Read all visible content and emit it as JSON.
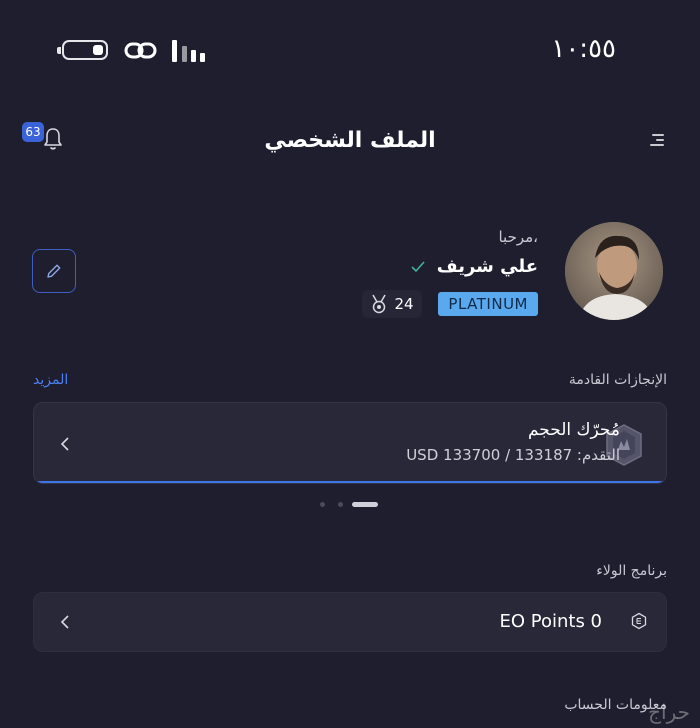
{
  "status_bar": {
    "time": "١٠:٥٥"
  },
  "header": {
    "title": "الملف الشخصي",
    "notification_count": "63"
  },
  "profile": {
    "greeting": "مرحبا،",
    "name": "علي شريف",
    "tier": "PLATINUM",
    "medal_count": "24"
  },
  "achievements": {
    "section_title": "الإنجازات القادمة",
    "more_label": "المزيد",
    "card": {
      "name": "مُحرّك الحجم",
      "progress_text": "التقدم: 133187 / 133700 USD",
      "progress_fraction": 0.996
    },
    "pager": {
      "count": 3,
      "active_index": 0
    }
  },
  "loyalty": {
    "section_title": "برنامج الولاء",
    "points_text": "EO Points 0"
  },
  "account": {
    "section_title": "معلومات الحساب"
  },
  "watermark": "حراج",
  "colors": {
    "background": "#1e1e2e",
    "card": "#282838",
    "accent": "#3d74e8",
    "tier_badge": "#5aa9ee"
  }
}
